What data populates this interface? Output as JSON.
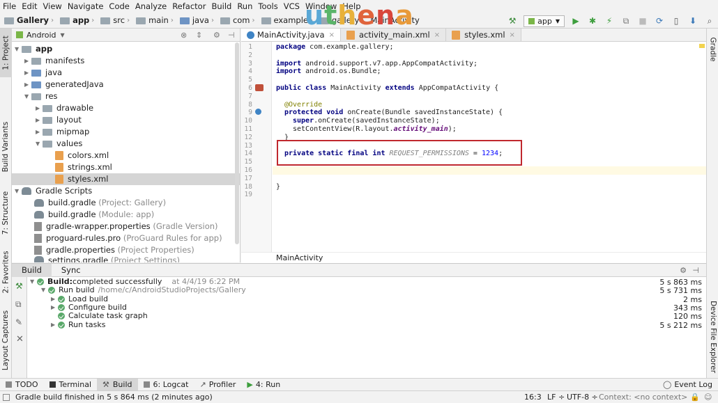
{
  "menu": [
    "File",
    "Edit",
    "View",
    "Navigate",
    "Code",
    "Analyze",
    "Refactor",
    "Build",
    "Run",
    "Tools",
    "VCS",
    "Window",
    "Help"
  ],
  "breadcrumbs": {
    "project": "Gallery",
    "app": "app",
    "src": "src",
    "main": "main",
    "java": "java",
    "com": "com",
    "example": "example",
    "gallery": "gallery",
    "file": "MainActivity"
  },
  "logo": "uthena",
  "run_config": "app",
  "project_panel": {
    "view": "Android",
    "side_tab": "1: Project",
    "tree": [
      {
        "label": "app",
        "bold": true
      },
      {
        "label": "manifests"
      },
      {
        "label": "java"
      },
      {
        "label": "generatedJava"
      },
      {
        "label": "res"
      },
      {
        "label": "drawable"
      },
      {
        "label": "layout"
      },
      {
        "label": "mipmap"
      },
      {
        "label": "values"
      },
      {
        "label": "colors.xml"
      },
      {
        "label": "strings.xml"
      },
      {
        "label": "styles.xml"
      },
      {
        "label": "Gradle Scripts"
      },
      {
        "label": "build.gradle",
        "note": "(Project: Gallery)"
      },
      {
        "label": "build.gradle",
        "note": "(Module: app)"
      },
      {
        "label": "gradle-wrapper.properties",
        "note": "(Gradle Version)"
      },
      {
        "label": "proguard-rules.pro",
        "note": "(ProGuard Rules for app)"
      },
      {
        "label": "gradle.properties",
        "note": "(Project Properties)"
      },
      {
        "label": "settings.gradle",
        "note": "(Project Settings)"
      }
    ]
  },
  "left_tabs": [
    "1: Project",
    "Build Variants",
    "7: Structure",
    "2: Favorites",
    "Layout Captures"
  ],
  "right_tabs": [
    "Gradle",
    "Device File Explorer"
  ],
  "editor_tabs": [
    "MainActivity.java",
    "activity_main.xml",
    "styles.xml"
  ],
  "code_lines": [
    "1",
    "2",
    "3",
    "4",
    "5",
    "6",
    "7",
    "8",
    "9",
    "10",
    "11",
    "12",
    "13",
    "14",
    "15",
    "16",
    "17",
    "18",
    "19"
  ],
  "code": {
    "l1a": "package ",
    "l1b": "com.example.gallery;",
    "l3a": "import ",
    "l3b": "android.support.v7.app.AppCompatActivity;",
    "l4a": "import ",
    "l4b": "android.os.Bundle;",
    "l6a": "public class ",
    "l6b": "MainActivity ",
    "l6c": "extends ",
    "l6d": "AppCompatActivity {",
    "l8": "@Override",
    "l9a": "protected void ",
    "l9b": "onCreate(Bundle savedInstanceState) {",
    "l10a": "super",
    ".": "",
    "l10b": ".onCreate(savedInstanceState);",
    "l11a": "setContentView(R.layout.",
    "l11b": "activity_main",
    "l11c": ");",
    "l12": "}",
    "l14a": "private static final int ",
    "l14b": "REQUEST_PERMISSIONS",
    "l14c": " = ",
    "l14d": "1234",
    "l14e": ";",
    "l18": "}"
  },
  "editor_breadcrumb": "MainActivity",
  "build_tabs": [
    "Build",
    "Sync"
  ],
  "build": [
    {
      "label": "Build:",
      "rest": " completed successfully",
      "extra": "at 4/4/19 6:22 PM",
      "time": "5 s 863 ms"
    },
    {
      "label": "Run build",
      "rest": "",
      "extra": "/home/c/AndroidStudioProjects/Gallery",
      "time": "5 s 731 ms"
    },
    {
      "label": "Load build",
      "time": "2 ms"
    },
    {
      "label": "Configure build",
      "time": "343 ms"
    },
    {
      "label": "Calculate task graph",
      "time": "120 ms"
    },
    {
      "label": "Run tasks",
      "time": "5 s 212 ms"
    }
  ],
  "bottom_tabs": [
    "TODO",
    "Terminal",
    "Build",
    "6: Logcat",
    "Profiler",
    "4: Run"
  ],
  "event_log": "Event Log",
  "status": {
    "message": "Gradle build finished in 5 s 864 ms (2 minutes ago)",
    "pos": "16:3",
    "lf": "LF ÷",
    "enc": "UTF-8 ÷",
    "context": "Context: <no context>"
  }
}
